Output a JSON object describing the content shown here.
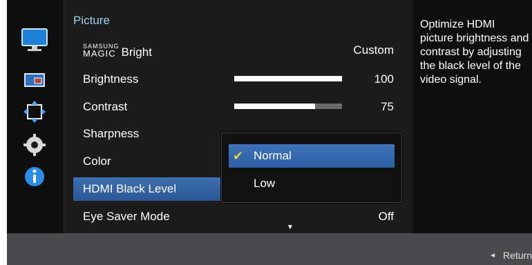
{
  "menu": {
    "title": "Picture",
    "magic_top": "SAMSUNG",
    "magic_bottom": "MAGIC",
    "magic_suffix": "Bright",
    "items": [
      {
        "label": "",
        "value": "Custom"
      },
      {
        "label": "Brightness",
        "value": "100",
        "level": 1.0
      },
      {
        "label": "Contrast",
        "value": "75",
        "level": 0.75
      },
      {
        "label": "Sharpness",
        "value": ""
      },
      {
        "label": "Color",
        "value": ""
      },
      {
        "label": "HDMI Black Level",
        "value": ""
      },
      {
        "label": "Eye Saver Mode",
        "value": "Off"
      }
    ],
    "selected_item": "HDMI Black Level"
  },
  "dropdown": {
    "options": [
      {
        "label": "Normal",
        "selected": true
      },
      {
        "label": "Low",
        "selected": false
      }
    ]
  },
  "help_text": "Optimize HDMI picture brightness and contrast by adjusting the black level of the video signal.",
  "footer": {
    "return_label": "Return"
  },
  "colors": {
    "accent_title": "#9ad2f0",
    "selection": "#3462a3",
    "checkmark": "#f0d236"
  },
  "icons": [
    "picture-icon",
    "screen-icon",
    "position-icon",
    "settings-icon",
    "info-icon"
  ]
}
